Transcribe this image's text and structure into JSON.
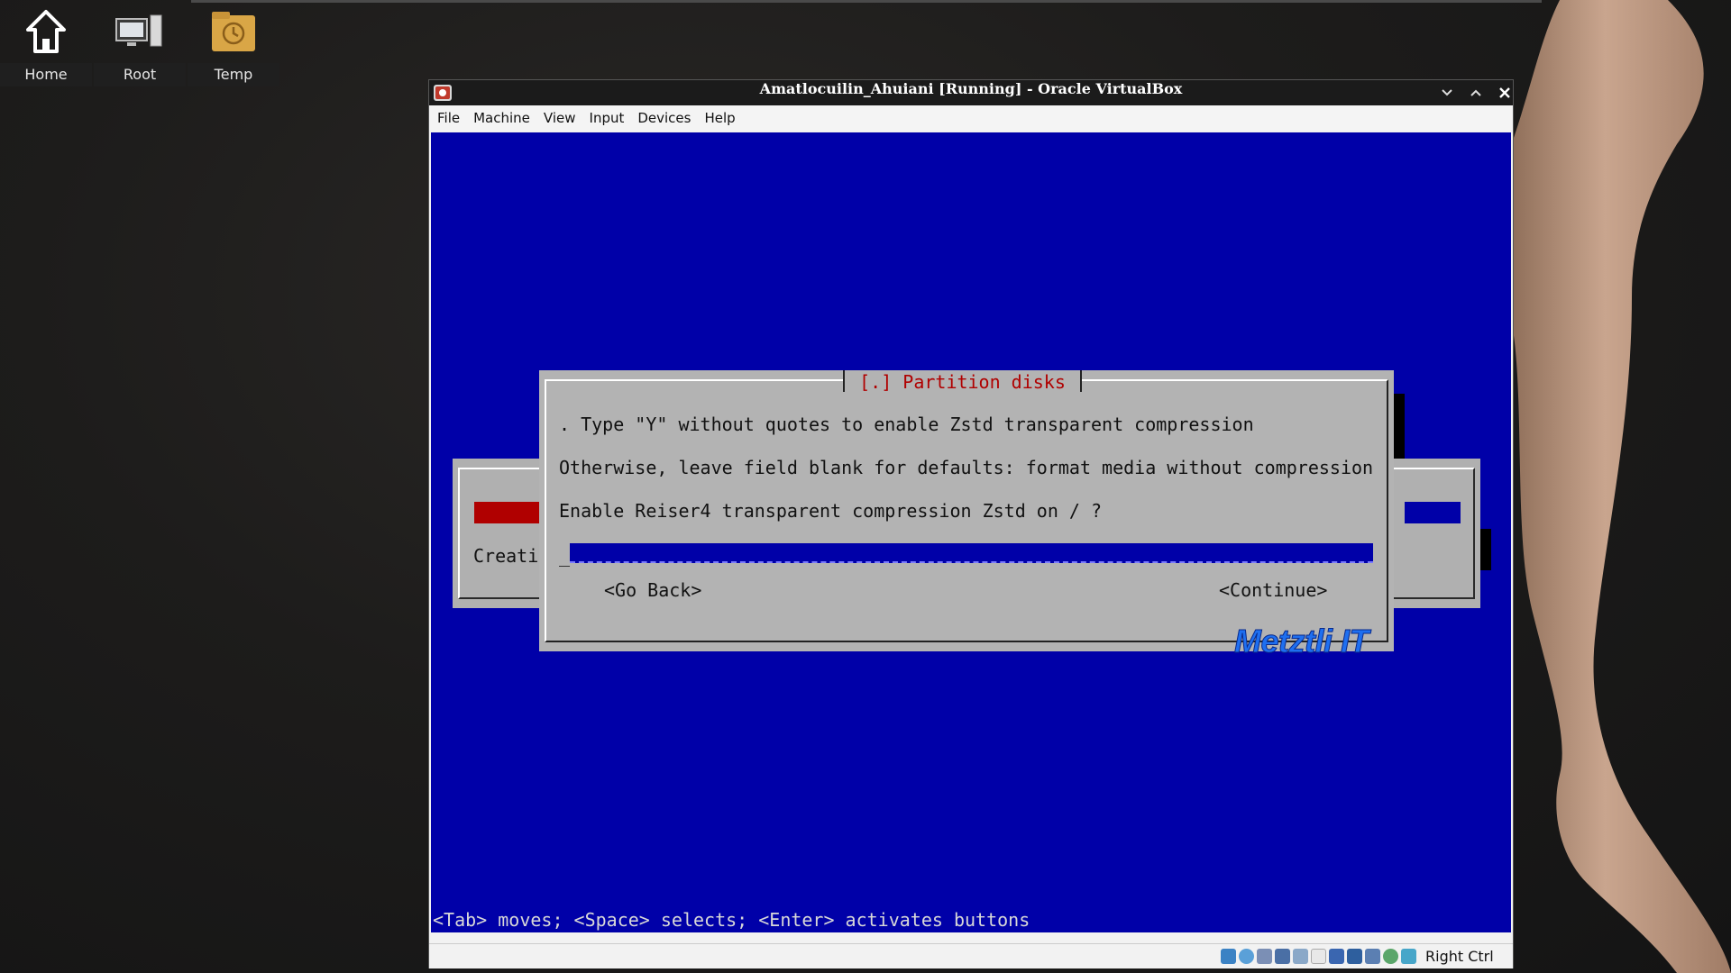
{
  "desktop": {
    "icons": [
      {
        "label": "Home",
        "icon": "home-icon"
      },
      {
        "label": "Root",
        "icon": "computer-icon"
      },
      {
        "label": "Temp",
        "icon": "folder-clock-icon"
      }
    ]
  },
  "window": {
    "title": "Amatlocuilin_Ahuiani [Running] - Oracle VirtualBox",
    "controls": [
      "minimize-icon",
      "maximize-icon",
      "close-icon"
    ],
    "menu": [
      "File",
      "Machine",
      "View",
      "Input",
      "Devices",
      "Help"
    ]
  },
  "vm": {
    "background_dialog": {
      "text_partial": "Creati"
    },
    "dialog": {
      "title": "[.] Partition disks",
      "lines": [
        ". Type \"Y\" without quotes to enable Zstd transparent compression",
        "Otherwise, leave field blank for defaults: format media without compression",
        "Enable Reiser4 transparent compression Zstd on / ?"
      ],
      "input_value": "_",
      "go_back_label": "<Go Back>",
      "continue_label": "<Continue>"
    },
    "watermark": "Metztli IT",
    "help_line": "<Tab> moves; <Space> selects; <Enter> activates buttons"
  },
  "statusbar": {
    "host_key": "Right Ctrl"
  },
  "colors": {
    "vm_blue": "#0000a8",
    "dialog_gray": "#b3b3b3",
    "title_red": "#b00000",
    "watermark_blue": "#1e6ff0"
  }
}
